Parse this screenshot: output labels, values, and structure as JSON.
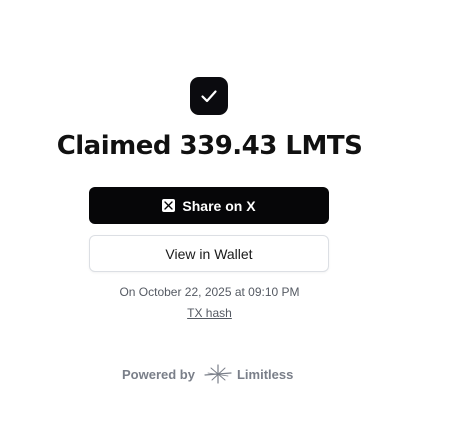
{
  "status": {
    "title": "Claimed 339.43 LMTS",
    "icon": "check-icon"
  },
  "actions": {
    "share_label": "Share on X",
    "share_icon": "x-logo-icon",
    "wallet_label": "View in Wallet"
  },
  "details": {
    "date_text": "On October 22, 2025 at 09:10 PM",
    "tx_link_label": "TX hash"
  },
  "footer": {
    "powered_by_label": "Powered by",
    "brand_name": "Limitless",
    "brand_icon": "limitless-logo-icon"
  },
  "colors": {
    "primary": "#060608",
    "muted_text": "#555a63",
    "footer_text": "#7a7f89"
  }
}
